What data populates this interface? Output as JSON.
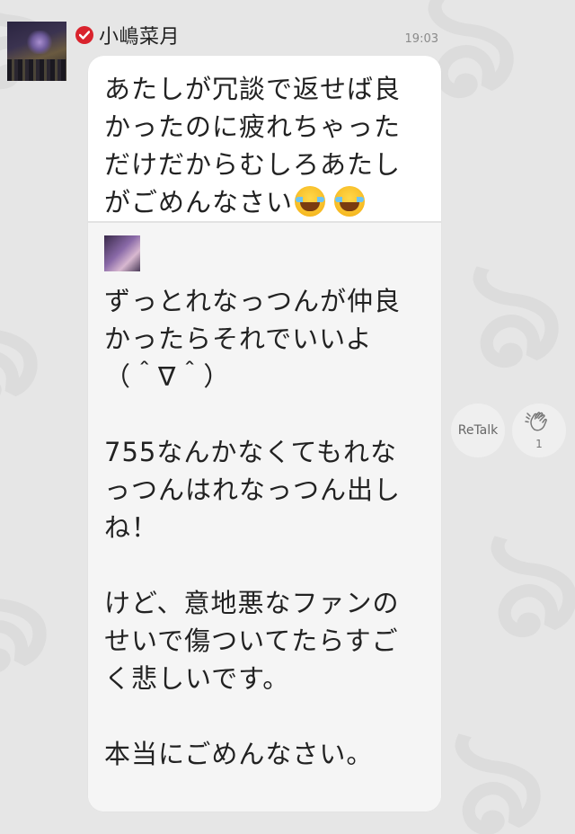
{
  "post": {
    "sender_name": "小嶋菜月",
    "time": "19:03",
    "message_lines": [
      "あたしが冗談で返せば良",
      "かったのに疲れちゃった",
      "だけだからむしろあたし",
      "がごめんなさい"
    ],
    "emojis": [
      "face-with-tears-of-joy",
      "face-with-tears-of-joy"
    ]
  },
  "quoted": {
    "text": "ずっとれなっつんが仲良\nかったらそれでいいよ\n（＾∇＾）\n\n755なんかなくてもれな\nっつんはれなっつん出し\nね！\n\nけど、意地悪なファンの\nせいで傷ついてたらすご\nく悲しいです。\n\n本当にごめんなさい。"
  },
  "actions": {
    "retalk_label": "ReTalk",
    "clap_count": "1"
  },
  "icons": {
    "verified": "verified-check-icon",
    "clap": "clap-icon"
  },
  "colors": {
    "verified_red": "#d9232d",
    "background": "#e6e6e6"
  }
}
